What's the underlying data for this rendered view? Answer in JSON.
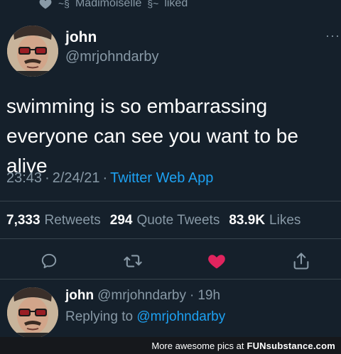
{
  "liked_banner": {
    "user": "Madimoiselle",
    "action": "liked",
    "icon": "heart-icon"
  },
  "tweet": {
    "display_name": "john",
    "handle": "@mrjohndarby",
    "text_line1": "swimming is so embarrassing",
    "text_line2": "everyone can see you want to be alive",
    "time": "23:43",
    "date": "2/24/21",
    "source": "Twitter Web App",
    "more_icon": "more-dots-icon"
  },
  "stats": {
    "retweets_count": "7,333",
    "retweets_label": "Retweets",
    "quotes_count": "294",
    "quotes_label": "Quote Tweets",
    "likes_count": "83.9K",
    "likes_label": "Likes"
  },
  "actions": {
    "reply_icon": "reply-icon",
    "retweet_icon": "retweet-icon",
    "like_icon": "heart-icon",
    "share_icon": "share-icon",
    "like_color": "#e0245e"
  },
  "reply": {
    "display_name": "john",
    "handle": "@mrjohndarby",
    "separator": "·",
    "age": "19h",
    "replying_prefix": "Replying to",
    "replying_to": "@mrjohndarby"
  },
  "watermark": {
    "text": "More awesome pics at",
    "brand": "FUNsubstance.com"
  },
  "colors": {
    "background": "#15202b",
    "secondary_text": "#8899a6",
    "link": "#1da1f2",
    "divider": "#38444d"
  }
}
